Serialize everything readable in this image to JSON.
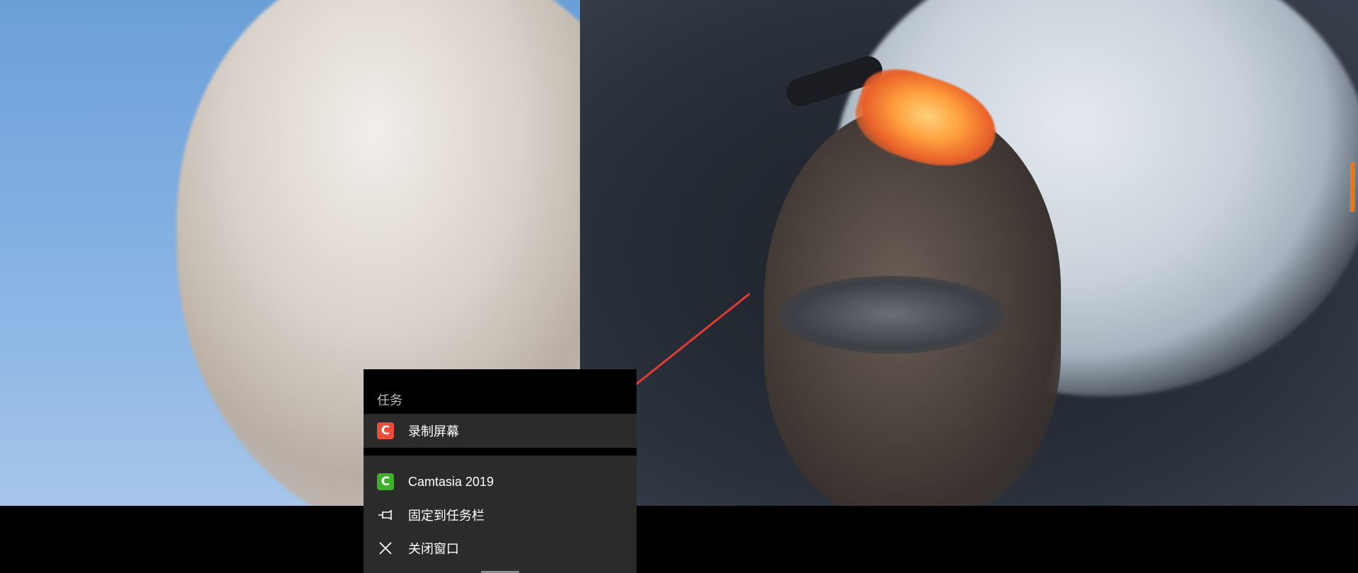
{
  "jump_list": {
    "header": "任务",
    "task_items": [
      {
        "label": "录制屏幕",
        "icon": "camtasia-recorder-icon",
        "icon_color": "#e84e3a"
      }
    ],
    "app_items": [
      {
        "label": "Camtasia 2019",
        "icon": "camtasia-app-icon",
        "icon_color": "#3fae2a"
      },
      {
        "label": "固定到任务栏",
        "icon": "pin-icon"
      },
      {
        "label": "关闭窗口",
        "icon": "close-icon"
      }
    ]
  },
  "annotation": {
    "color": "#e53935",
    "type": "arrow"
  },
  "colors": {
    "menu_bg": "#2b2b2b",
    "tasks_bg": "#000000",
    "accent_scroll": "#e37a22"
  }
}
